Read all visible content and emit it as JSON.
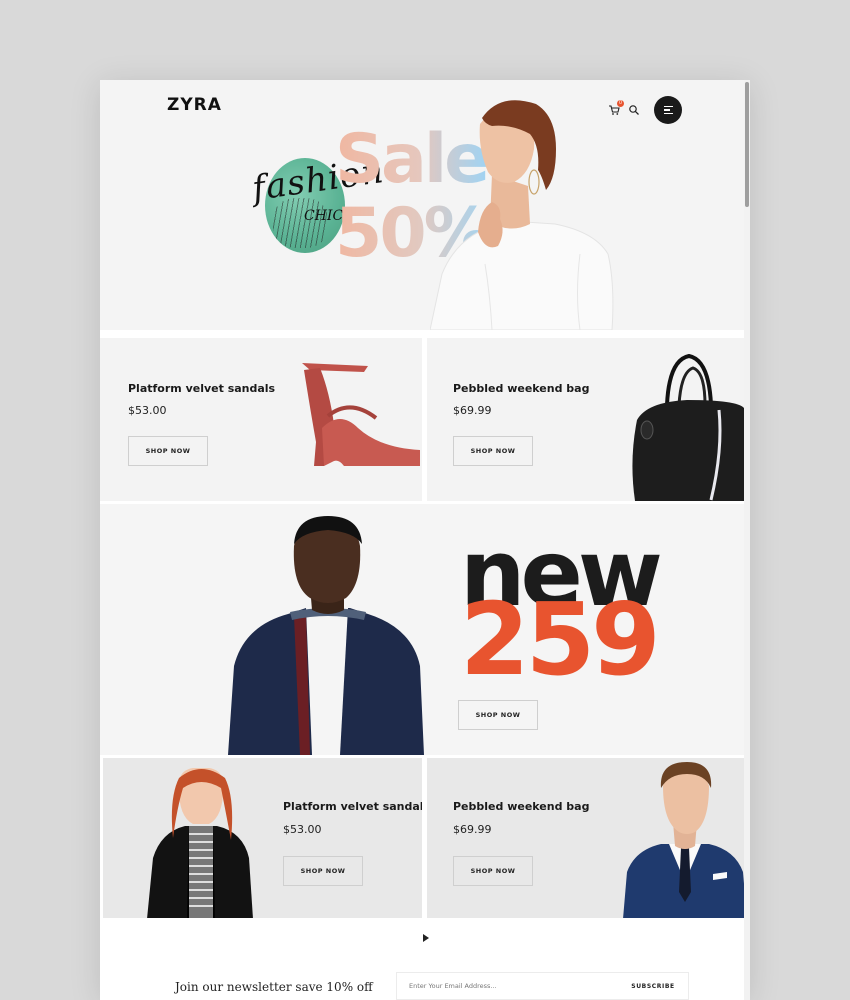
{
  "brand": {
    "logo": "ZYRA"
  },
  "header": {
    "cart_badge": "0"
  },
  "hero": {
    "script": "fashion",
    "script_sub": "CHIC",
    "sale": "Sale",
    "percent": "50%"
  },
  "products": [
    {
      "name": "Platform velvet sandals",
      "price": "$53.00",
      "button": "SHOP NOW"
    },
    {
      "name": "Pebbled weekend bag",
      "price": "$69.99",
      "button": "SHOP NOW"
    }
  ],
  "feature": {
    "headline": "new",
    "number": "259",
    "button": "SHOP NOW"
  },
  "products_row2": [
    {
      "name": "Platform velvet sandals",
      "price": "$53.00",
      "button": "SHOP NOW"
    },
    {
      "name": "Pebbled weekend bag",
      "price": "$69.99",
      "button": "SHOP NOW"
    }
  ],
  "newsletter": {
    "title": "Join our newsletter save 10% off",
    "placeholder": "Enter Your Email Address...",
    "button": "SUBSCRIBE"
  },
  "colors": {
    "accent": "#e8542f",
    "dark": "#1c1c1c",
    "tile_bg": "#f3f3f3",
    "tile_grey": "#e8e8e8"
  }
}
